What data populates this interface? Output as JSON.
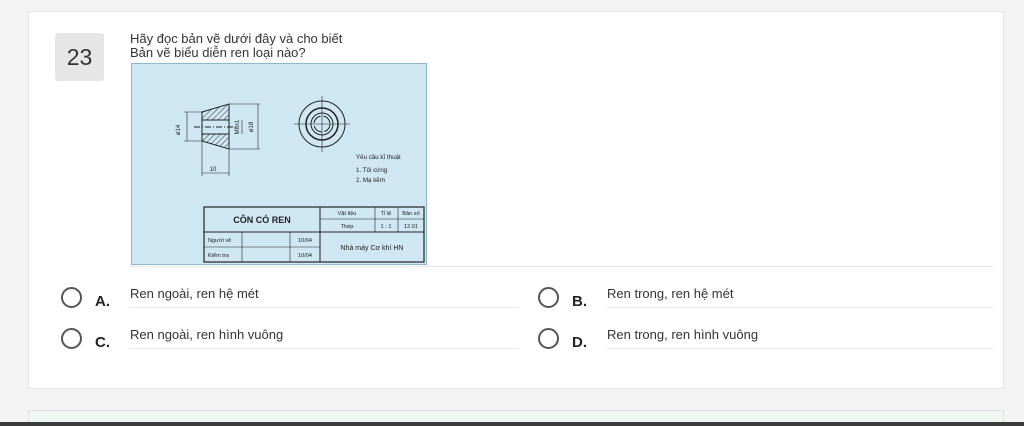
{
  "question": {
    "number": "23",
    "line1": "Hãy đọc bản vẽ dưới đây và cho biết",
    "line2": "Bản vẽ biểu diễn ren loại nào?"
  },
  "drawing": {
    "dim_d14": "ø14",
    "dim_m8": "M8x1",
    "dim_d18": "ø18",
    "dim_10": "10",
    "req_title": "Yêu cầu kĩ thuật",
    "req_1": "1. Tôi cứng",
    "req_2": "2. Mạ kẽm",
    "title": "CÔN CÓ REN",
    "h_material": "Vật liệu",
    "h_scale": "Tỉ lệ",
    "h_sheet": "Bản số",
    "v_material": "Thép",
    "v_scale": "1 : 1",
    "v_sheet": "12.01",
    "drawer_label": "Người vẽ",
    "drawer_date": "10/04",
    "checker_label": "Kiểm tra",
    "checker_date": "10/04",
    "factory": "Nhà máy Cơ khí HN"
  },
  "options": [
    {
      "letter": "A.",
      "text": "Ren ngoài, ren hệ mét"
    },
    {
      "letter": "B.",
      "text": "Ren trong, ren hệ mét"
    },
    {
      "letter": "C.",
      "text": "Ren ngoài, ren hình vuông"
    },
    {
      "letter": "D.",
      "text": "Ren trong, ren hình vuông"
    }
  ]
}
